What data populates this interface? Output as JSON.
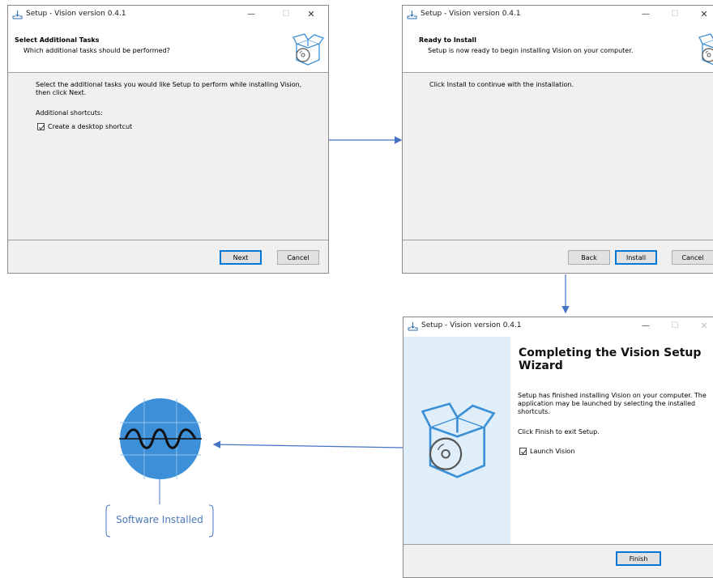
{
  "window1": {
    "title": "Setup - Vision version 0.4.1",
    "header_title": "Select Additional Tasks",
    "header_subtitle": "Which additional tasks should be performed?",
    "body_line1": "Select the additional tasks you would like Setup to perform while installing Vision,",
    "body_line2": "then click Next.",
    "section_label": "Additional shortcuts:",
    "checkbox_label": "Create a desktop shortcut",
    "next_label": "Next",
    "cancel_label": "Cancel"
  },
  "window2": {
    "title": "Setup - Vision version 0.4.1",
    "header_title": "Ready to Install",
    "header_subtitle": "Setup is now ready to begin installing Vision on your computer.",
    "body_text": "Click Install to continue with the installation.",
    "back_label": "Back",
    "install_label": "Install",
    "cancel_label": "Cancel"
  },
  "window3": {
    "title": "Setup - Vision version 0.4.1",
    "heading_line1": "Completing the Vision Setup",
    "heading_line2": "Wizard",
    "body_line1": "Setup has finished installing Vision on your computer. The",
    "body_line2": "application may be launched by selecting the installed",
    "body_line3": "shortcuts.",
    "body_line4": "Click Finish to exit Setup.",
    "checkbox_label": "Launch Vision",
    "finish_label": "Finish"
  },
  "final_label": "Software Installed",
  "colors": {
    "arrow": "#4472c4",
    "accent_button_border": "#0078d7",
    "icon_blue": "#3a8fd6",
    "circle_blue": "#3d8fd8",
    "left_panel": "#dfeef8"
  }
}
